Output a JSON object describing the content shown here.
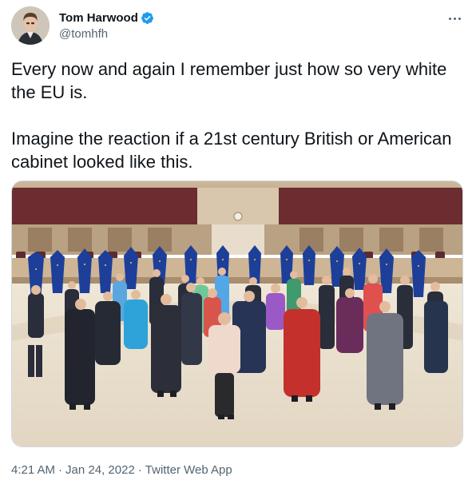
{
  "author": {
    "display_name": "Tom Harwood",
    "handle": "@tomhfh",
    "verified": true
  },
  "icons": {
    "verified": "verified-badge-icon",
    "more": "more-options-icon"
  },
  "colors": {
    "verified_blue": "#1d9bf0",
    "secondary_text": "#536471",
    "primary_text": "#0f1419"
  },
  "tweet": {
    "text": "Every now and again I remember just how so very white the EU is.\n\nImagine the reaction if a 21st century British or American cabinet looked like this."
  },
  "footer": {
    "time": "4:21 AM",
    "date": "Jan 24, 2022",
    "separator": "·",
    "source": "Twitter Web App"
  }
}
